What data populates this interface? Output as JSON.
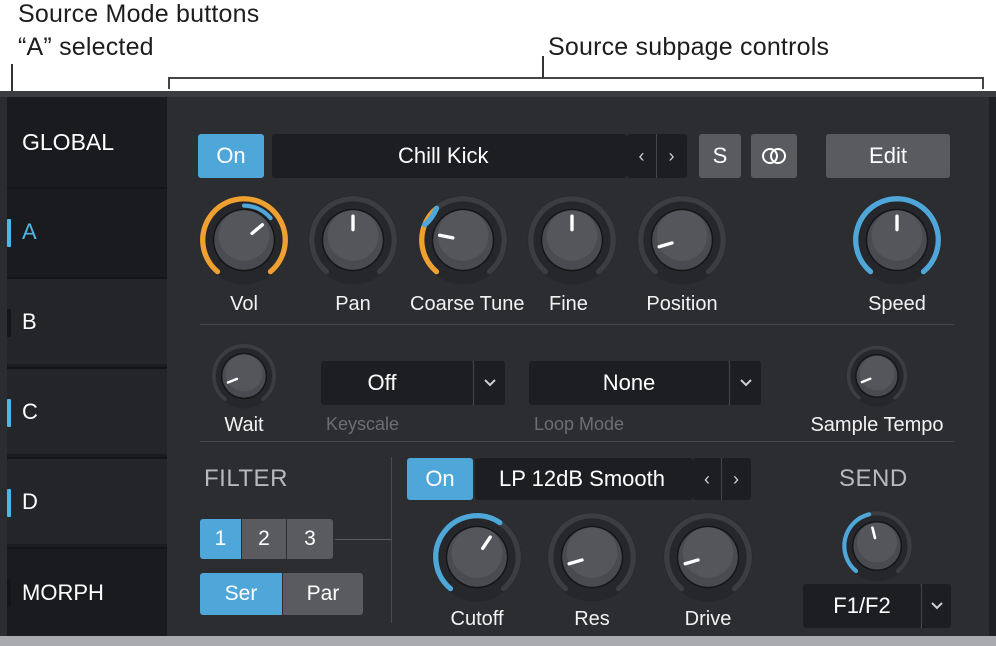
{
  "callouts": {
    "mode_line1": "Source Mode buttons",
    "mode_line2": "“A” selected",
    "subpage": "Source subpage controls"
  },
  "sidebar": {
    "items": [
      {
        "label": "GLOBAL",
        "indicator": "none",
        "selected": false
      },
      {
        "label": "A",
        "indicator": "on",
        "selected": true
      },
      {
        "label": "B",
        "indicator": "off",
        "selected": false
      },
      {
        "label": "C",
        "indicator": "on",
        "selected": false
      },
      {
        "label": "D",
        "indicator": "on",
        "selected": false
      },
      {
        "label": "MORPH",
        "indicator": "off",
        "selected": false
      }
    ]
  },
  "source": {
    "on_label": "On",
    "sample_name": "Chill Kick",
    "prev_label": "‹",
    "next_label": "›",
    "solo_label": "S",
    "link_icon": "link-rings-icon",
    "edit_label": "Edit"
  },
  "knobs_row1": [
    {
      "label": "Vol",
      "value": 0.68,
      "ring": "orange"
    },
    {
      "label": "Pan",
      "value": 0.5,
      "ring": "none"
    },
    {
      "label": "Coarse Tune",
      "value": 0.22,
      "ring": "orange-blue"
    },
    {
      "label": "Fine",
      "value": 0.5,
      "ring": "none"
    },
    {
      "label": "Position",
      "value": 0.12,
      "ring": "none"
    },
    {
      "label": "Speed",
      "value": 0.5,
      "ring": "blue"
    }
  ],
  "row2": {
    "wait_label": "Wait",
    "wait_value": 0.1,
    "keyscale_value": "Off",
    "keyscale_label": "Keyscale",
    "loopmode_value": "None",
    "loopmode_label": "Loop Mode",
    "sample_tempo_label": "Sample Tempo",
    "sample_tempo_value": 0.1
  },
  "filter": {
    "section_label": "FILTER",
    "slots": [
      "1",
      "2",
      "3"
    ],
    "active_slot": "1",
    "routing": [
      "Ser",
      "Par"
    ],
    "active_routing": "Ser",
    "on_label": "On",
    "type_value": "LP 12dB Smooth",
    "prev_label": "‹",
    "next_label": "›",
    "knobs": [
      {
        "label": "Cutoff",
        "value": 0.62,
        "ring": "blue"
      },
      {
        "label": "Res",
        "value": 0.12,
        "ring": "none"
      },
      {
        "label": "Drive",
        "value": 0.12,
        "ring": "none"
      }
    ]
  },
  "send": {
    "section_label": "SEND",
    "value": 0.45,
    "destination": "F1/F2"
  },
  "colors": {
    "accent_blue": "#4ea7d8",
    "accent_orange": "#f0a030",
    "panel_bg": "#2c2d30",
    "sidebar_bg": "#1a1b1e"
  }
}
